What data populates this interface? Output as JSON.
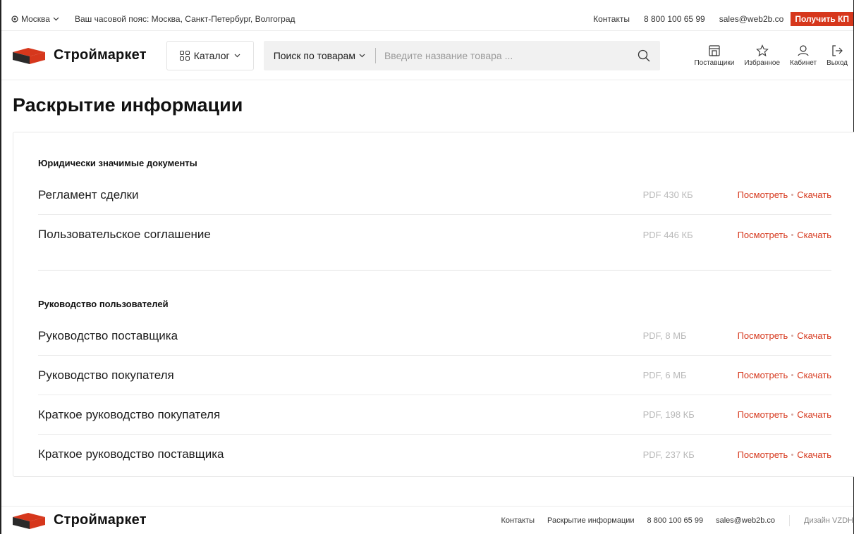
{
  "topbar": {
    "city": "Москва",
    "timezone": "Ваш часовой пояс: Москва, Санкт-Петербург, Волгоград",
    "contacts": "Контакты",
    "phone": "8 800 100 65 99",
    "email": "sales@web2b.co",
    "cta": "Получить КП"
  },
  "header": {
    "logo": "Строймаркет",
    "catalog": "Каталог",
    "search_mode": "Поиск по товарам",
    "search_placeholder": "Введите название товара ...",
    "icons": [
      {
        "label": "Поставщики",
        "icon": "store-icon"
      },
      {
        "label": "Избранное",
        "icon": "star-icon"
      },
      {
        "label": "Кабинет",
        "icon": "user-icon"
      },
      {
        "label": "Выход",
        "icon": "logout-icon"
      }
    ]
  },
  "page": {
    "title": "Раскрытие информации",
    "sections": [
      {
        "heading": "Юридически значимые документы",
        "docs": [
          {
            "name": "Регламент сделки",
            "meta": "PDF 430 КБ",
            "view": "Посмотреть",
            "download": "Скачать"
          },
          {
            "name": "Пользовательское соглашение",
            "meta": "PDF 446 КБ",
            "view": "Посмотреть",
            "download": "Скачать"
          }
        ]
      },
      {
        "heading": "Руководство пользователей",
        "docs": [
          {
            "name": "Руководство поставщика",
            "meta": "PDF, 8 МБ",
            "view": "Посмотреть",
            "download": "Скачать"
          },
          {
            "name": "Руководство покупателя",
            "meta": "PDF, 6 МБ",
            "view": "Посмотреть",
            "download": "Скачать"
          },
          {
            "name": "Краткое руководство покупателя",
            "meta": "PDF, 198 КБ",
            "view": "Посмотреть",
            "download": "Скачать"
          },
          {
            "name": "Краткое руководство поставщика",
            "meta": "PDF, 237 КБ",
            "view": "Посмотреть",
            "download": "Скачать"
          }
        ]
      }
    ]
  },
  "footer": {
    "logo": "Строймаркет",
    "contacts": "Контакты",
    "disclosure": "Раскрытие информации",
    "phone": "8 800 100 65 99",
    "email": "sales@web2b.co",
    "design": "Дизайн VZDH"
  },
  "colors": {
    "accent": "#d6371c",
    "logo_dark": "#222222",
    "meta_gray": "#b9b9b9"
  }
}
